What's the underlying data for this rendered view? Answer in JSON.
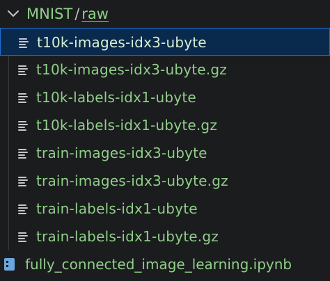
{
  "breadcrumb": {
    "folder": "MNIST",
    "separator": "/",
    "subfolder": "raw"
  },
  "files": [
    {
      "label": "t10k-images-idx3-ubyte",
      "icon": "text-file-icon",
      "selected": true
    },
    {
      "label": "t10k-images-idx3-ubyte.gz",
      "icon": "text-file-icon",
      "selected": false
    },
    {
      "label": "t10k-labels-idx1-ubyte",
      "icon": "text-file-icon",
      "selected": false
    },
    {
      "label": "t10k-labels-idx1-ubyte.gz",
      "icon": "text-file-icon",
      "selected": false
    },
    {
      "label": "train-images-idx3-ubyte",
      "icon": "text-file-icon",
      "selected": false
    },
    {
      "label": "train-images-idx3-ubyte.gz",
      "icon": "text-file-icon",
      "selected": false
    },
    {
      "label": "train-labels-idx1-ubyte",
      "icon": "text-file-icon",
      "selected": false
    },
    {
      "label": "train-labels-idx1-ubyte.gz",
      "icon": "text-file-icon",
      "selected": false
    }
  ],
  "notebook": {
    "label": "fully_connected_image_learning.ipynb",
    "icon": "notebook-icon"
  },
  "colors": {
    "background": "#1b1c1e",
    "text_untracked": "#8fcf88",
    "selection_bg": "#0a2a4d",
    "selection_border": "#1f6fd1"
  }
}
